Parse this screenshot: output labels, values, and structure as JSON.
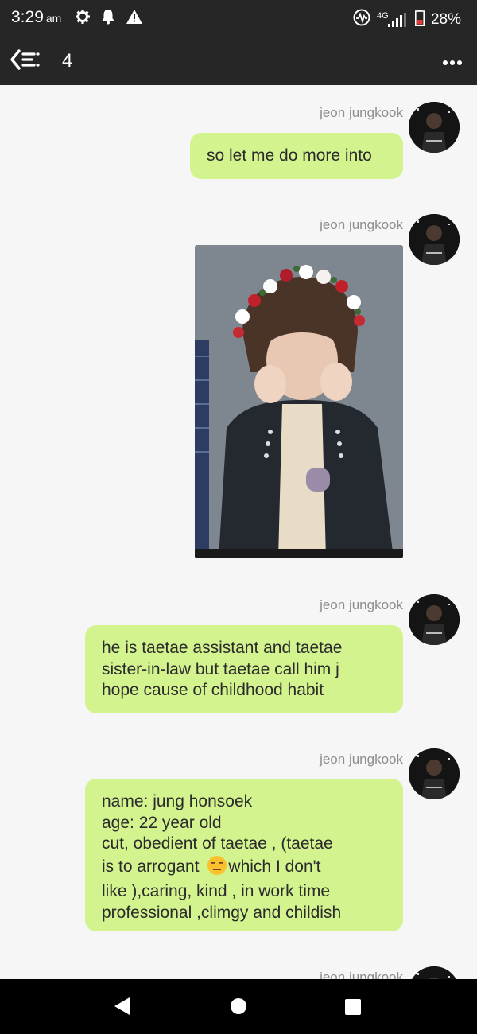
{
  "status_bar": {
    "time": "3:29",
    "ampm": "am",
    "network": "4G",
    "battery": "28%",
    "icons": [
      "settings-icon",
      "notification-bell-icon",
      "warning-icon",
      "hotspot-icon",
      "signal-icon",
      "battery-icon"
    ]
  },
  "toolbar": {
    "count": "4",
    "icons": [
      "back-list-icon",
      "more-options-icon"
    ]
  },
  "messages": [
    {
      "sender": "jeon jungkook",
      "text": "so let me do more into"
    },
    {
      "sender": "jeon jungkook",
      "image": "photo of person wearing flower crown"
    },
    {
      "sender": "jeon jungkook",
      "lines": [
        "he is taetae assistant and taetae",
        "sister-in-law but taetae call him j",
        "hope cause of childhood habit"
      ]
    },
    {
      "sender": "jeon jungkook",
      "lines": [
        "name: jung honsoek",
        "age: 22 year old",
        "cut, obedient of taetae , (taetae",
        "is to arrogant",
        "which I don't",
        "like ),caring, kind , in work time",
        "professional ,climgy and childish"
      ],
      "emoji": "expressionless-face-emoji"
    },
    {
      "sender": "jeon jungkook"
    }
  ],
  "colors": {
    "bar": "#262626",
    "bubble": "#d3f38f",
    "background": "#f6f6f6",
    "sender": "#8d8d8d",
    "nav": "#000000"
  },
  "nav_icons": [
    "back-triangle-icon",
    "home-circle-icon",
    "recents-square-icon"
  ]
}
